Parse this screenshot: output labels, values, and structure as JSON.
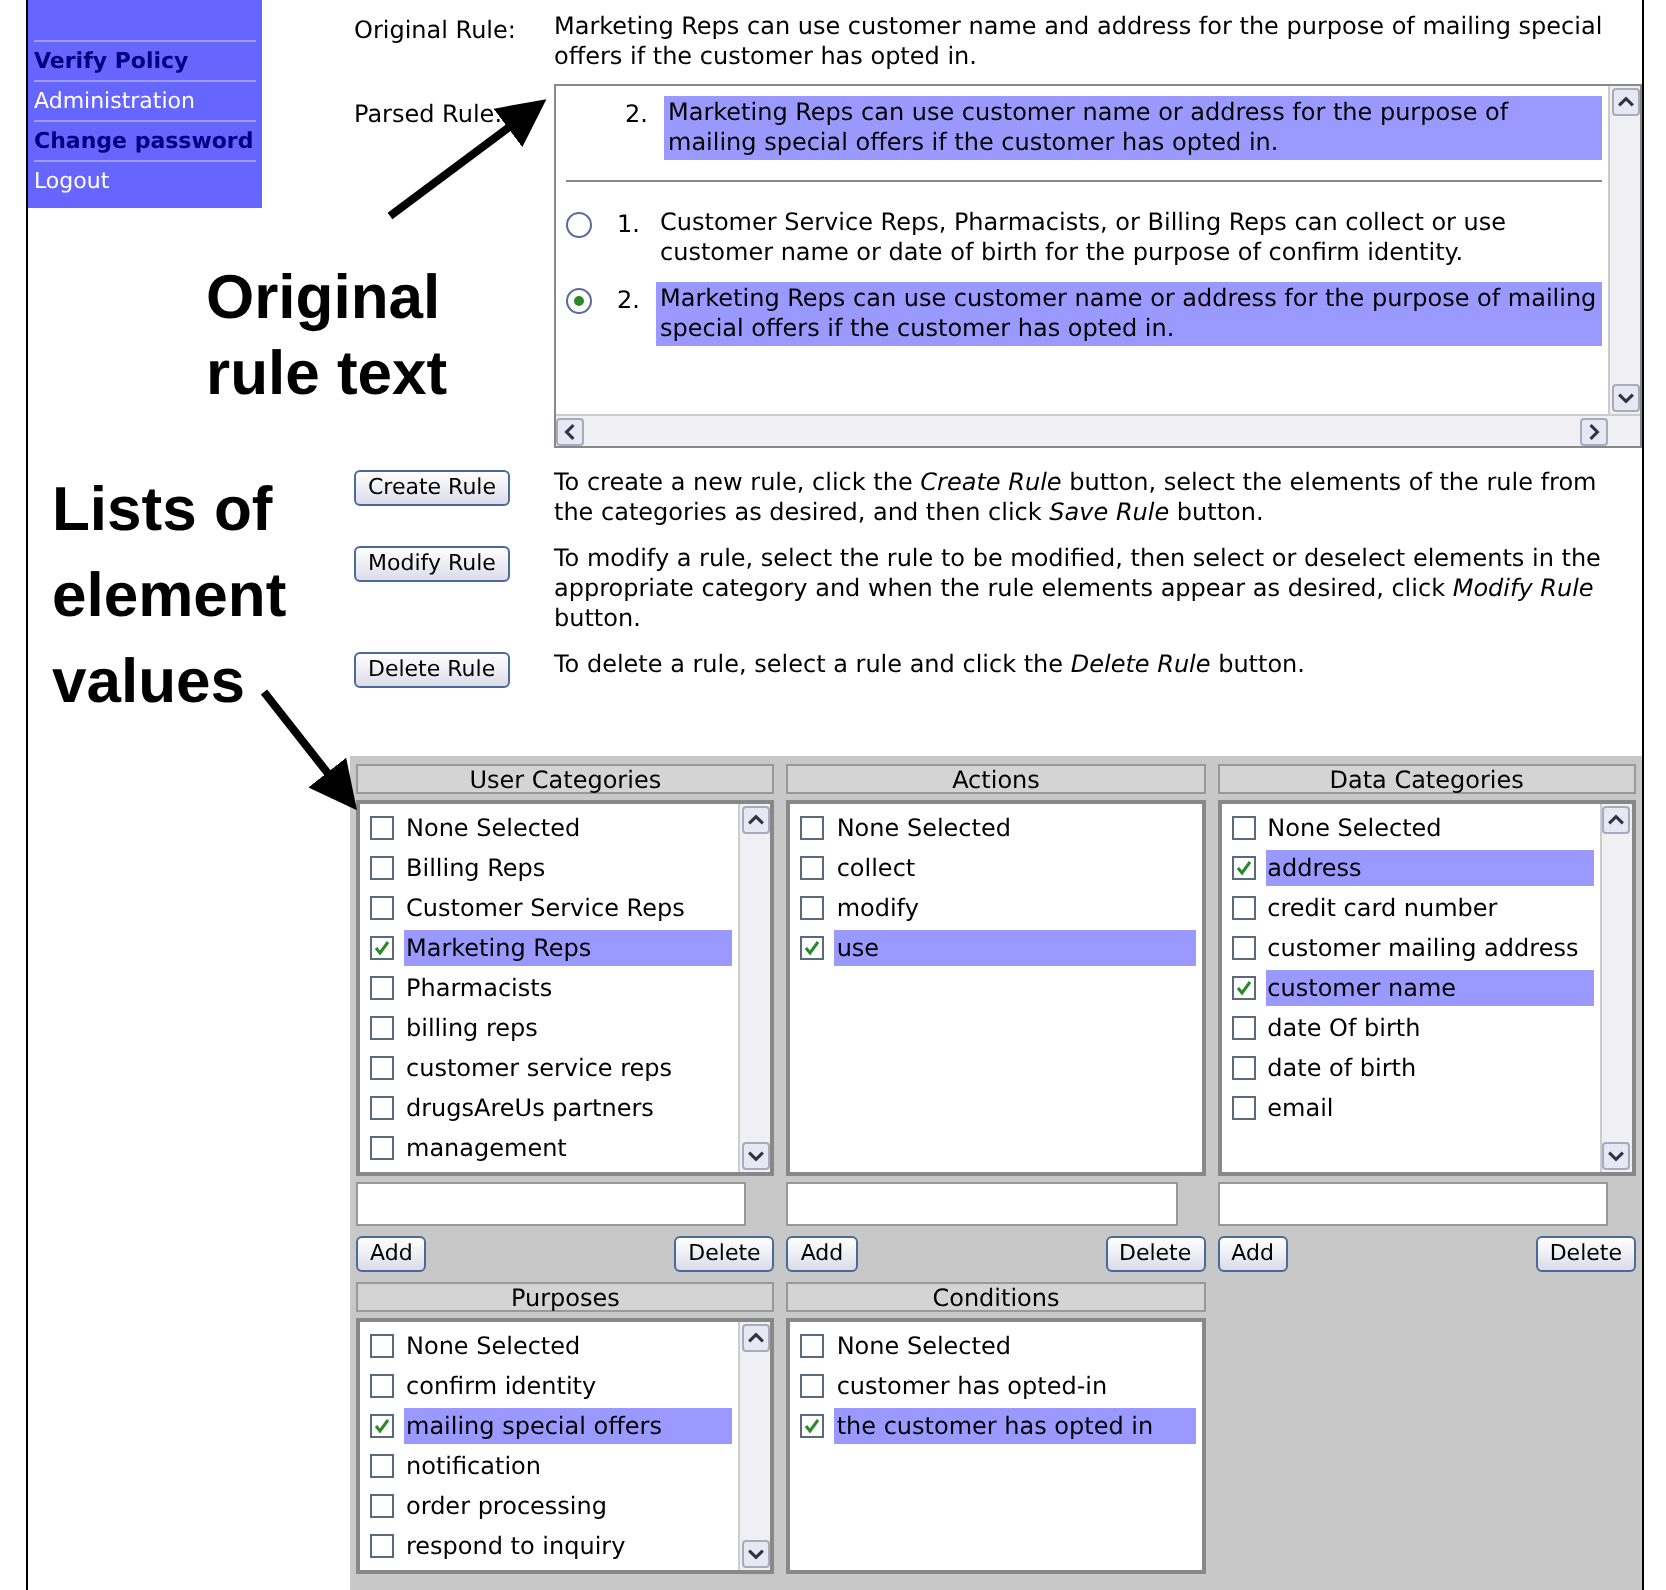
{
  "sidebar": {
    "items": [
      {
        "label": "Verify Policy",
        "bold": true
      },
      {
        "label": "Administration",
        "bold": false
      },
      {
        "label": "Change password",
        "bold": true
      },
      {
        "label": "Logout",
        "bold": false
      }
    ]
  },
  "rule": {
    "original_label": "Original Rule:",
    "original_text": "Marketing Reps can use customer name and address for the purpose of mailing special offers if the customer has opted in.",
    "parsed_label": "Parsed Rule:",
    "current": {
      "number": "2.",
      "text": "Marketing Reps can use customer name or address for the purpose of mailing special offers if the customer has opted in."
    },
    "options": [
      {
        "number": "1.",
        "text": "Customer Service Reps, Pharmacists, or Billing Reps can collect or use customer name or date of birth for the purpose of confirm identity.",
        "selected": false
      },
      {
        "number": "2.",
        "text": "Marketing Reps can use customer name or address for the purpose of mailing special offers if the customer has opted in.",
        "selected": true
      }
    ]
  },
  "actions": [
    {
      "button": "Create Rule",
      "description": "To create a new rule, click the *Create Rule* button, select the elements of the rule from the categories as desired, and then click *Save Rule* button."
    },
    {
      "button": "Modify Rule",
      "description": "To modify a rule, select the rule to be modified, then select or deselect elements in the appropriate category and when the rule elements appear as desired, click *Modify Rule* button."
    },
    {
      "button": "Delete Rule",
      "description": "To delete a rule, select a rule and click the *Delete Rule* button."
    }
  ],
  "categories": [
    {
      "title": "User Categories",
      "scrollable": true,
      "add_button": "Add",
      "delete_button": "Delete",
      "items": [
        {
          "label": "None Selected",
          "checked": false
        },
        {
          "label": "Billing Reps",
          "checked": false
        },
        {
          "label": "Customer Service Reps",
          "checked": false
        },
        {
          "label": "Marketing Reps",
          "checked": true
        },
        {
          "label": "Pharmacists",
          "checked": false
        },
        {
          "label": "billing reps",
          "checked": false
        },
        {
          "label": "customer service reps",
          "checked": false
        },
        {
          "label": "drugsAreUs partners",
          "checked": false
        },
        {
          "label": "management",
          "checked": false
        }
      ]
    },
    {
      "title": "Actions",
      "scrollable": false,
      "add_button": "Add",
      "delete_button": "Delete",
      "items": [
        {
          "label": "None Selected",
          "checked": false
        },
        {
          "label": "collect",
          "checked": false
        },
        {
          "label": "modify",
          "checked": false
        },
        {
          "label": "use",
          "checked": true
        }
      ]
    },
    {
      "title": "Data Categories",
      "scrollable": true,
      "add_button": "Add",
      "delete_button": "Delete",
      "items": [
        {
          "label": "None Selected",
          "checked": false
        },
        {
          "label": "address",
          "checked": true
        },
        {
          "label": "credit card number",
          "checked": false
        },
        {
          "label": "customer mailing address",
          "checked": false
        },
        {
          "label": "customer name",
          "checked": true
        },
        {
          "label": "date Of birth",
          "checked": false
        },
        {
          "label": "date of birth",
          "checked": false
        },
        {
          "label": "email",
          "checked": false
        }
      ]
    },
    {
      "title": "Purposes",
      "scrollable": true,
      "items": [
        {
          "label": "None Selected",
          "checked": false
        },
        {
          "label": "confirm identity",
          "checked": false
        },
        {
          "label": "mailing special offers",
          "checked": true
        },
        {
          "label": "notification",
          "checked": false
        },
        {
          "label": "order processing",
          "checked": false
        },
        {
          "label": "respond to inquiry",
          "checked": false
        }
      ]
    },
    {
      "title": "Conditions",
      "scrollable": false,
      "items": [
        {
          "label": "None Selected",
          "checked": false
        },
        {
          "label": "customer has opted-in",
          "checked": false
        },
        {
          "label": "the customer has opted in",
          "checked": true
        }
      ]
    }
  ],
  "annotations": [
    {
      "text": "Original rule text"
    },
    {
      "text": "Lists of element values"
    }
  ]
}
